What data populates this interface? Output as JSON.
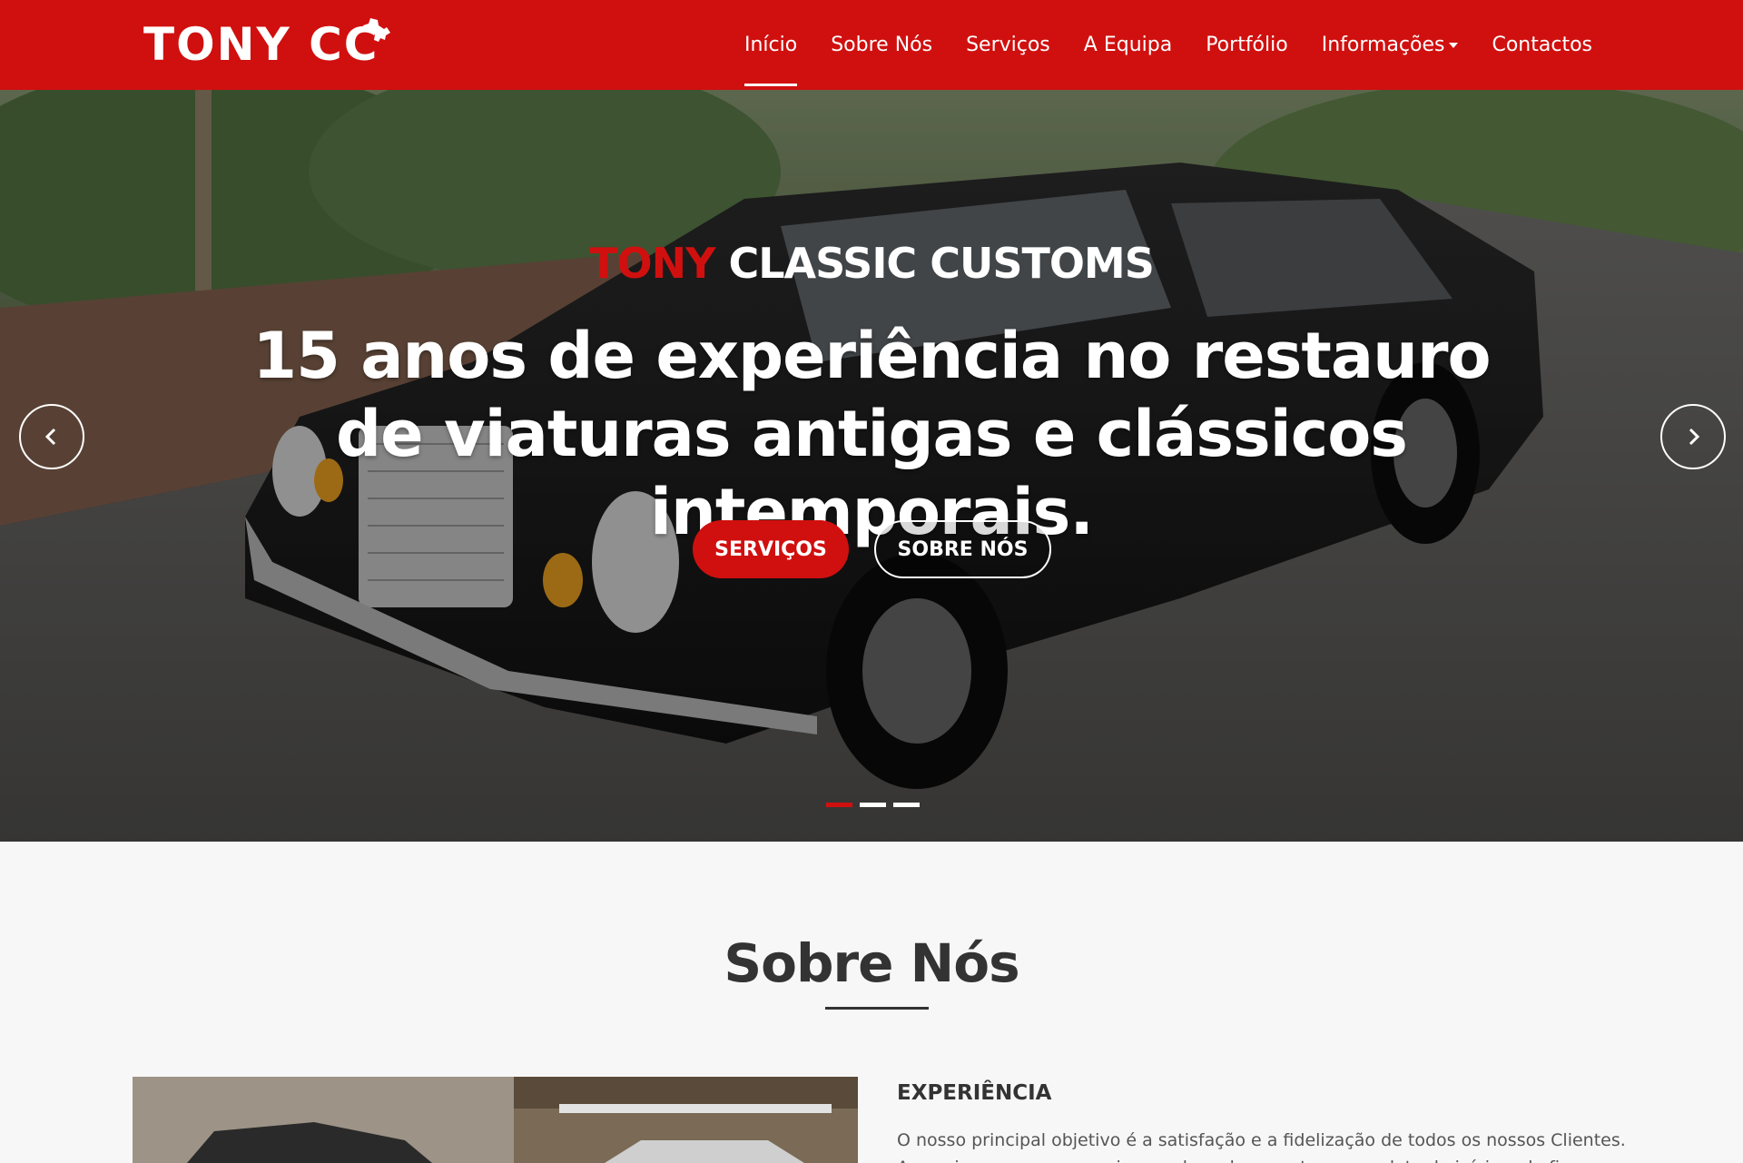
{
  "brand": {
    "name": "TONY CC"
  },
  "nav": {
    "items": [
      {
        "label": "Início",
        "active": true
      },
      {
        "label": "Sobre Nós"
      },
      {
        "label": "Serviços"
      },
      {
        "label": "A Equipa"
      },
      {
        "label": "Portfólio"
      },
      {
        "label": "Informações",
        "dropdown": true
      },
      {
        "label": "Contactos"
      }
    ]
  },
  "hero": {
    "kicker_red": "TONY",
    "kicker_rest": " CLASSIC CUSTOMS",
    "title": "15 anos de experiência no restauro de viaturas antigas e clássicos intemporais.",
    "primary_button": "SERVIÇOS",
    "secondary_button": "SOBRE NÓS",
    "slides_total": 3,
    "active_slide": 1
  },
  "about": {
    "title": "Sobre Nós",
    "heading": "EXPERIÊNCIA",
    "text": "O nosso principal objetivo é a satisfação e a fidelização de todos os nossos Clientes.",
    "text_cut": "Assumimos um compromisso onde cada carro tem uma data de início e de fim."
  },
  "colors": {
    "accent": "#d0100f",
    "text_dark": "#333333",
    "bg_light": "#f7f7f7"
  },
  "icons": {
    "prev": "chevron-left-icon",
    "next": "chevron-right-icon",
    "dropdown": "caret-down-icon"
  }
}
